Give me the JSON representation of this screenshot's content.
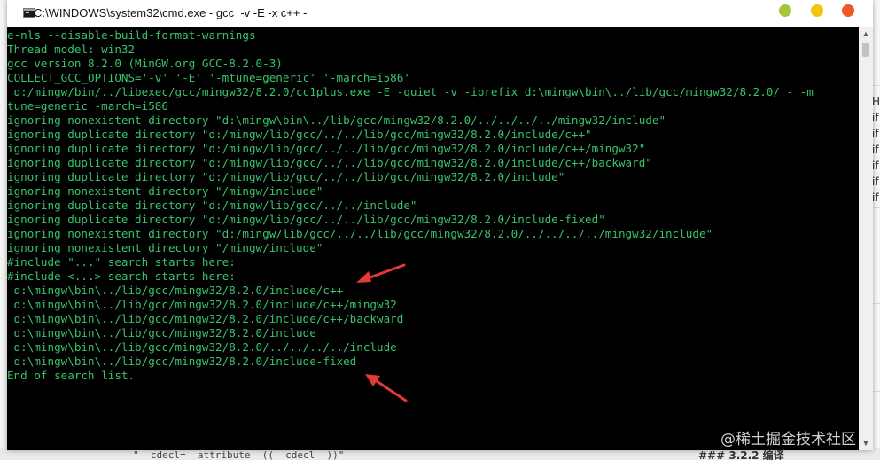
{
  "window": {
    "title": "C:\\WINDOWS\\system32\\cmd.exe - gcc  -v -E -x c++ -"
  },
  "console_lines": [
    "e-nls --disable-build-format-warnings",
    "Thread model: win32",
    "gcc version 8.2.0 (MinGW.org GCC-8.2.0-3)",
    "COLLECT_GCC_OPTIONS='-v' '-E' '-mtune=generic' '-march=i586'",
    " d:/mingw/bin/../libexec/gcc/mingw32/8.2.0/cc1plus.exe -E -quiet -v -iprefix d:\\mingw\\bin\\../lib/gcc/mingw32/8.2.0/ - -m",
    "tune=generic -march=i586",
    "ignoring nonexistent directory \"d:\\mingw\\bin\\../lib/gcc/mingw32/8.2.0/../../../../mingw32/include\"",
    "ignoring duplicate directory \"d:/mingw/lib/gcc/../../lib/gcc/mingw32/8.2.0/include/c++\"",
    "ignoring duplicate directory \"d:/mingw/lib/gcc/../../lib/gcc/mingw32/8.2.0/include/c++/mingw32\"",
    "ignoring duplicate directory \"d:/mingw/lib/gcc/../../lib/gcc/mingw32/8.2.0/include/c++/backward\"",
    "ignoring duplicate directory \"d:/mingw/lib/gcc/../../lib/gcc/mingw32/8.2.0/include\"",
    "ignoring nonexistent directory \"/mingw/include\"",
    "ignoring duplicate directory \"d:/mingw/lib/gcc/../../include\"",
    "ignoring duplicate directory \"d:/mingw/lib/gcc/../../lib/gcc/mingw32/8.2.0/include-fixed\"",
    "ignoring nonexistent directory \"d:/mingw/lib/gcc/../../lib/gcc/mingw32/8.2.0/../../../../mingw32/include\"",
    "ignoring nonexistent directory \"/mingw/include\"",
    "#include \"...\" search starts here:",
    "#include <...> search starts here:",
    " d:\\mingw\\bin\\../lib/gcc/mingw32/8.2.0/include/c++",
    " d:\\mingw\\bin\\../lib/gcc/mingw32/8.2.0/include/c++/mingw32",
    " d:\\mingw\\bin\\../lib/gcc/mingw32/8.2.0/include/c++/backward",
    " d:\\mingw\\bin\\../lib/gcc/mingw32/8.2.0/include",
    " d:\\mingw\\bin\\../lib/gcc/mingw32/8.2.0/../../../../include",
    " d:\\mingw\\bin\\../lib/gcc/mingw32/8.2.0/include-fixed",
    "End of search list."
  ],
  "background": {
    "right_fragments": [
      "H",
      "if",
      "if",
      "if",
      "if",
      "if",
      "if"
    ],
    "bottom_code": "\"  cdecl=  attribute  ((  cdecl  ))\"",
    "bottom_heading": "### 3.2.2 编译"
  },
  "watermark": "@稀土掘金技术社区",
  "colors": {
    "console_bg": "#000000",
    "console_text": "#39c26a",
    "arrow": "#e53935"
  }
}
